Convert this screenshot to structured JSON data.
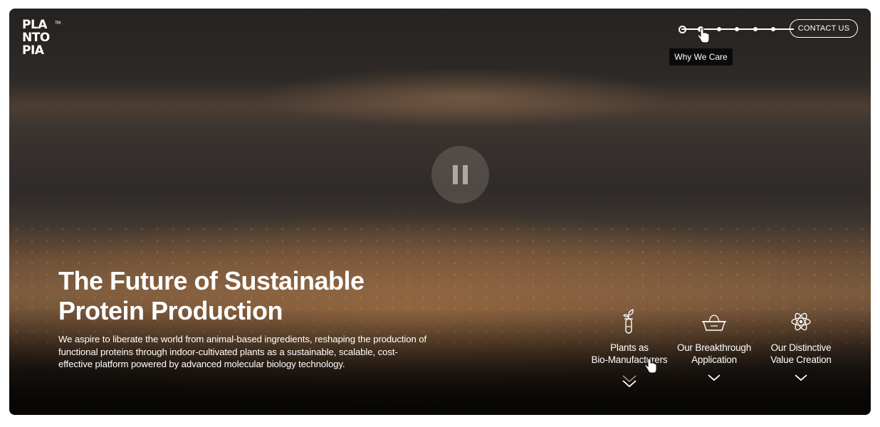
{
  "brand": {
    "logo_lines": [
      "PLA",
      "NTO",
      "PIA"
    ],
    "trademark": "TM"
  },
  "nav": {
    "progress_steps": 7,
    "active_step": 2,
    "tooltip": "Why We Care",
    "contact_label": "CONTACT US"
  },
  "hero": {
    "title": "The Future of Sustainable Protein Production",
    "description": "We aspire to liberate the world from animal-based ingredients, reshaping the production of functional proteins through indoor-cultivated plants as a sustainable, scalable, cost-effective platform powered by advanced molecular biology technology."
  },
  "video": {
    "control_icon": "pause-icon"
  },
  "features": [
    {
      "label_line1": "Plants as",
      "label_line2": "Bio-Manufacturers",
      "icon": "plant-test-tube-icon"
    },
    {
      "label_line1": "Our Breakthrough",
      "label_line2": "Application",
      "icon": "bowl-icon"
    },
    {
      "label_line1": "Our Distinctive",
      "label_line2": "Value Creation",
      "icon": "atom-icon"
    }
  ],
  "colors": {
    "text": "#ffffff",
    "tooltip_bg": "#0b0b0b",
    "accent_grain": "#7a5a3e"
  }
}
